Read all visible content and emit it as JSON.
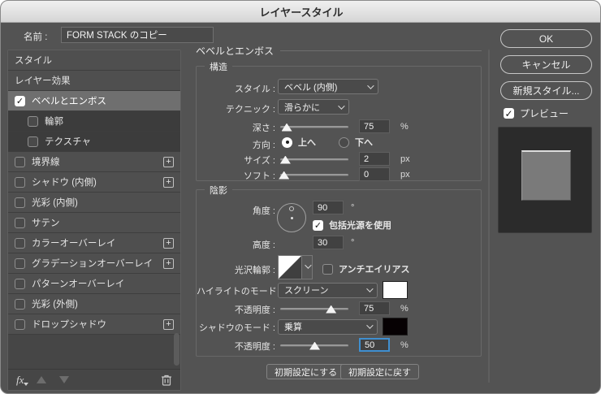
{
  "window": {
    "title": "レイヤースタイル"
  },
  "name_row": {
    "label": "名前 :",
    "value": "FORM STACK のコピー"
  },
  "actions": {
    "ok": "OK",
    "cancel": "キャンセル",
    "new_style": "新規スタイル...",
    "preview_label": "プレビュー"
  },
  "sidebar": {
    "items": [
      {
        "label": "スタイル"
      },
      {
        "label": "レイヤー効果"
      },
      {
        "label": "ベベルとエンボス",
        "checked": true
      },
      {
        "label": "輪郭"
      },
      {
        "label": "テクスチャ"
      },
      {
        "label": "境界線"
      },
      {
        "label": "シャドウ (内側)"
      },
      {
        "label": "光彩 (内側)"
      },
      {
        "label": "サテン"
      },
      {
        "label": "カラーオーバーレイ"
      },
      {
        "label": "グラデーションオーバーレイ"
      },
      {
        "label": "パターンオーバーレイ"
      },
      {
        "label": "光彩 (外側)"
      },
      {
        "label": "ドロップシャドウ"
      }
    ],
    "footer": {
      "fx": "fx"
    }
  },
  "panel": {
    "heading": "ベベルとエンボス",
    "structure": {
      "legend": "構造",
      "style": {
        "label": "スタイル :",
        "value": "ベベル (内側)"
      },
      "technique": {
        "label": "テクニック :",
        "value": "滑らかに"
      },
      "depth": {
        "label": "深さ :",
        "value": "75",
        "unit": "%"
      },
      "direction": {
        "label": "方向 :",
        "up": "上へ",
        "down": "下へ",
        "selected": "上へ"
      },
      "size": {
        "label": "サイズ :",
        "value": "2",
        "unit": "px"
      },
      "soften": {
        "label": "ソフト :",
        "value": "0",
        "unit": "px"
      }
    },
    "shading": {
      "legend": "陰影",
      "angle": {
        "label": "角度 :",
        "value": "90",
        "unit": "°"
      },
      "global_light": {
        "label": "包括光源を使用",
        "checked": true
      },
      "altitude": {
        "label": "高度 :",
        "value": "30",
        "unit": "°"
      },
      "gloss_contour": {
        "label": "光沢輪郭 :"
      },
      "anti_alias": {
        "label": "アンチエイリアス",
        "checked": false
      },
      "highlight_mode": {
        "label": "ハイライトのモード :",
        "value": "スクリーン",
        "swatch": "#ffffff"
      },
      "highlight_opacity": {
        "label": "不透明度 :",
        "value": "75",
        "unit": "%"
      },
      "shadow_mode": {
        "label": "シャドウのモード :",
        "value": "乗算",
        "swatch": "#060103"
      },
      "shadow_opacity": {
        "label": "不透明度 :",
        "value": "50",
        "unit": "%"
      }
    },
    "buttons": {
      "make_default": "初期設定にする",
      "reset_default": "初期設定に戻す"
    }
  },
  "colors": {
    "focus_ring": "#3f8fd0",
    "selected_row": "#6f6f6f"
  }
}
